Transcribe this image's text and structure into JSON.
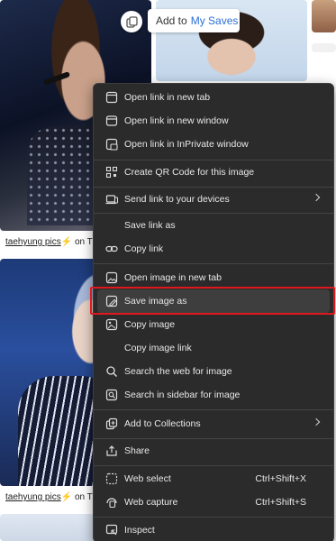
{
  "overlay": {
    "add_prefix": "Add to",
    "add_accent": "My Saves",
    "accent_color": "#2b6fd6"
  },
  "results": [
    {
      "caption_link": "taehyung pics",
      "caption_suffix": "⚡ on T"
    },
    {
      "caption_link": "taehyung pics",
      "caption_suffix": "⚡ on T"
    }
  ],
  "context_menu": {
    "items": [
      {
        "label": "Open link in new tab",
        "icon": "new-tab-icon"
      },
      {
        "label": "Open link in new window",
        "icon": "new-window-icon"
      },
      {
        "label": "Open link in InPrivate window",
        "icon": "inprivate-icon"
      },
      {
        "label": "Create QR Code for this image",
        "icon": "qr-code-icon"
      },
      {
        "label": "Send link to your devices",
        "icon": "devices-icon",
        "submenu": true
      },
      {
        "label": "Save link as",
        "icon": ""
      },
      {
        "label": "Copy link",
        "icon": "link-icon"
      },
      {
        "label": "Open image in new tab",
        "icon": "image-new-tab-icon"
      },
      {
        "label": "Save image as",
        "icon": "save-image-icon",
        "highlighted": true
      },
      {
        "label": "Copy image",
        "icon": "copy-image-icon"
      },
      {
        "label": "Copy image link",
        "icon": ""
      },
      {
        "label": "Search the web for image",
        "icon": "search-icon"
      },
      {
        "label": "Search in sidebar for image",
        "icon": "sidebar-search-icon"
      },
      {
        "label": "Add to Collections",
        "icon": "collections-icon",
        "submenu": true
      },
      {
        "label": "Share",
        "icon": "share-icon"
      },
      {
        "label": "Web select",
        "icon": "web-select-icon",
        "shortcut": "Ctrl+Shift+X"
      },
      {
        "label": "Web capture",
        "icon": "web-capture-icon",
        "shortcut": "Ctrl+Shift+S"
      },
      {
        "label": "Inspect",
        "icon": "inspect-icon"
      }
    ]
  },
  "colors": {
    "menu_bg": "#2b2b2b",
    "menu_text": "#e8e8e8",
    "highlight_border": "#e0181e"
  }
}
